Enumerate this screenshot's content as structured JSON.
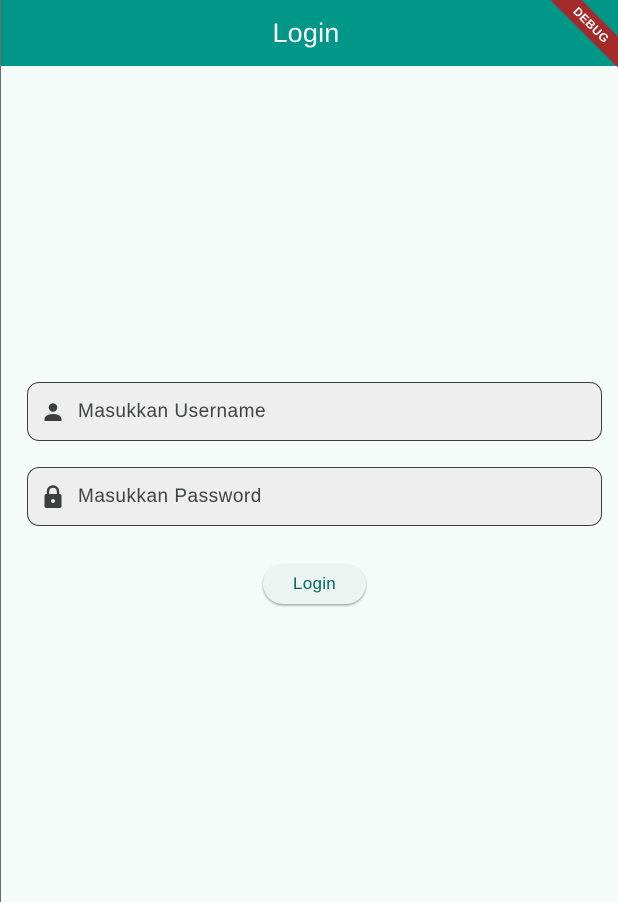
{
  "appbar": {
    "title": "Login",
    "color": "#009688"
  },
  "debug_banner": {
    "label": "DEBUG"
  },
  "form": {
    "username": {
      "placeholder": "Masukkan Username",
      "value": "",
      "icon": "person-icon"
    },
    "password": {
      "placeholder": "Masukkan Password",
      "value": "",
      "icon": "lock-icon"
    },
    "login_label": "Login"
  },
  "colors": {
    "background": "#f5fbf9",
    "field_fill": "#eeeeee",
    "button_text": "#006a60",
    "banner": "#a52a2a"
  }
}
